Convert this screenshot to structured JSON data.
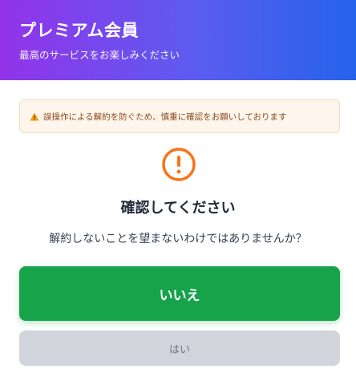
{
  "header": {
    "title": "プレミアム会員",
    "subtitle": "最高のサービスをお楽しみください"
  },
  "warning": {
    "icon": "warning-triangle-icon",
    "text": "誤操作による解約を防ぐため、慎重に確認をお願いしております"
  },
  "confirm": {
    "icon": "exclamation-circle-icon",
    "title": "確認してください",
    "question": "解約しないことを望まないわけではありませんか？"
  },
  "buttons": {
    "no_label": "いいえ",
    "yes_label": "はい"
  },
  "colors": {
    "header_gradient_start": "#9333ea",
    "header_gradient_end": "#2563eb",
    "alert_orange": "#f97316",
    "no_button": "#16a34a",
    "yes_button": "#d1d5db"
  }
}
